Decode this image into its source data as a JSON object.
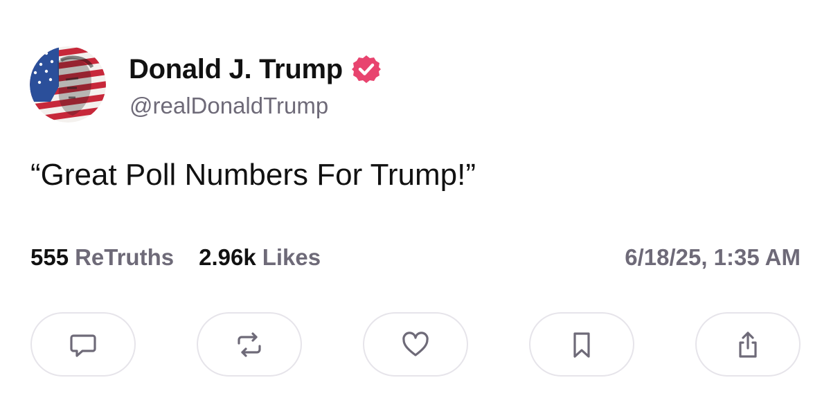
{
  "author": {
    "display_name": "Donald J. Trump",
    "handle": "@realDonaldTrump",
    "verified": true,
    "verified_color": "#e8446f",
    "avatar_icon": "flag-portrait-avatar"
  },
  "post": {
    "text": "“Great Poll Numbers For Trump!”"
  },
  "stats": {
    "retruths_count": "555",
    "retruths_label": "ReTruths",
    "likes_count": "2.96k",
    "likes_label": "Likes"
  },
  "timestamp": "6/18/25, 1:35 AM",
  "actions": [
    {
      "name": "reply",
      "icon": "comment-icon"
    },
    {
      "name": "retruth",
      "icon": "repost-icon"
    },
    {
      "name": "like",
      "icon": "heart-icon"
    },
    {
      "name": "bookmark",
      "icon": "bookmark-icon"
    },
    {
      "name": "share",
      "icon": "share-icon"
    }
  ],
  "colors": {
    "text_primary": "#111111",
    "text_secondary": "#6e6a78",
    "button_border": "#e6e4ea",
    "icon_stroke": "#6e6a78"
  }
}
